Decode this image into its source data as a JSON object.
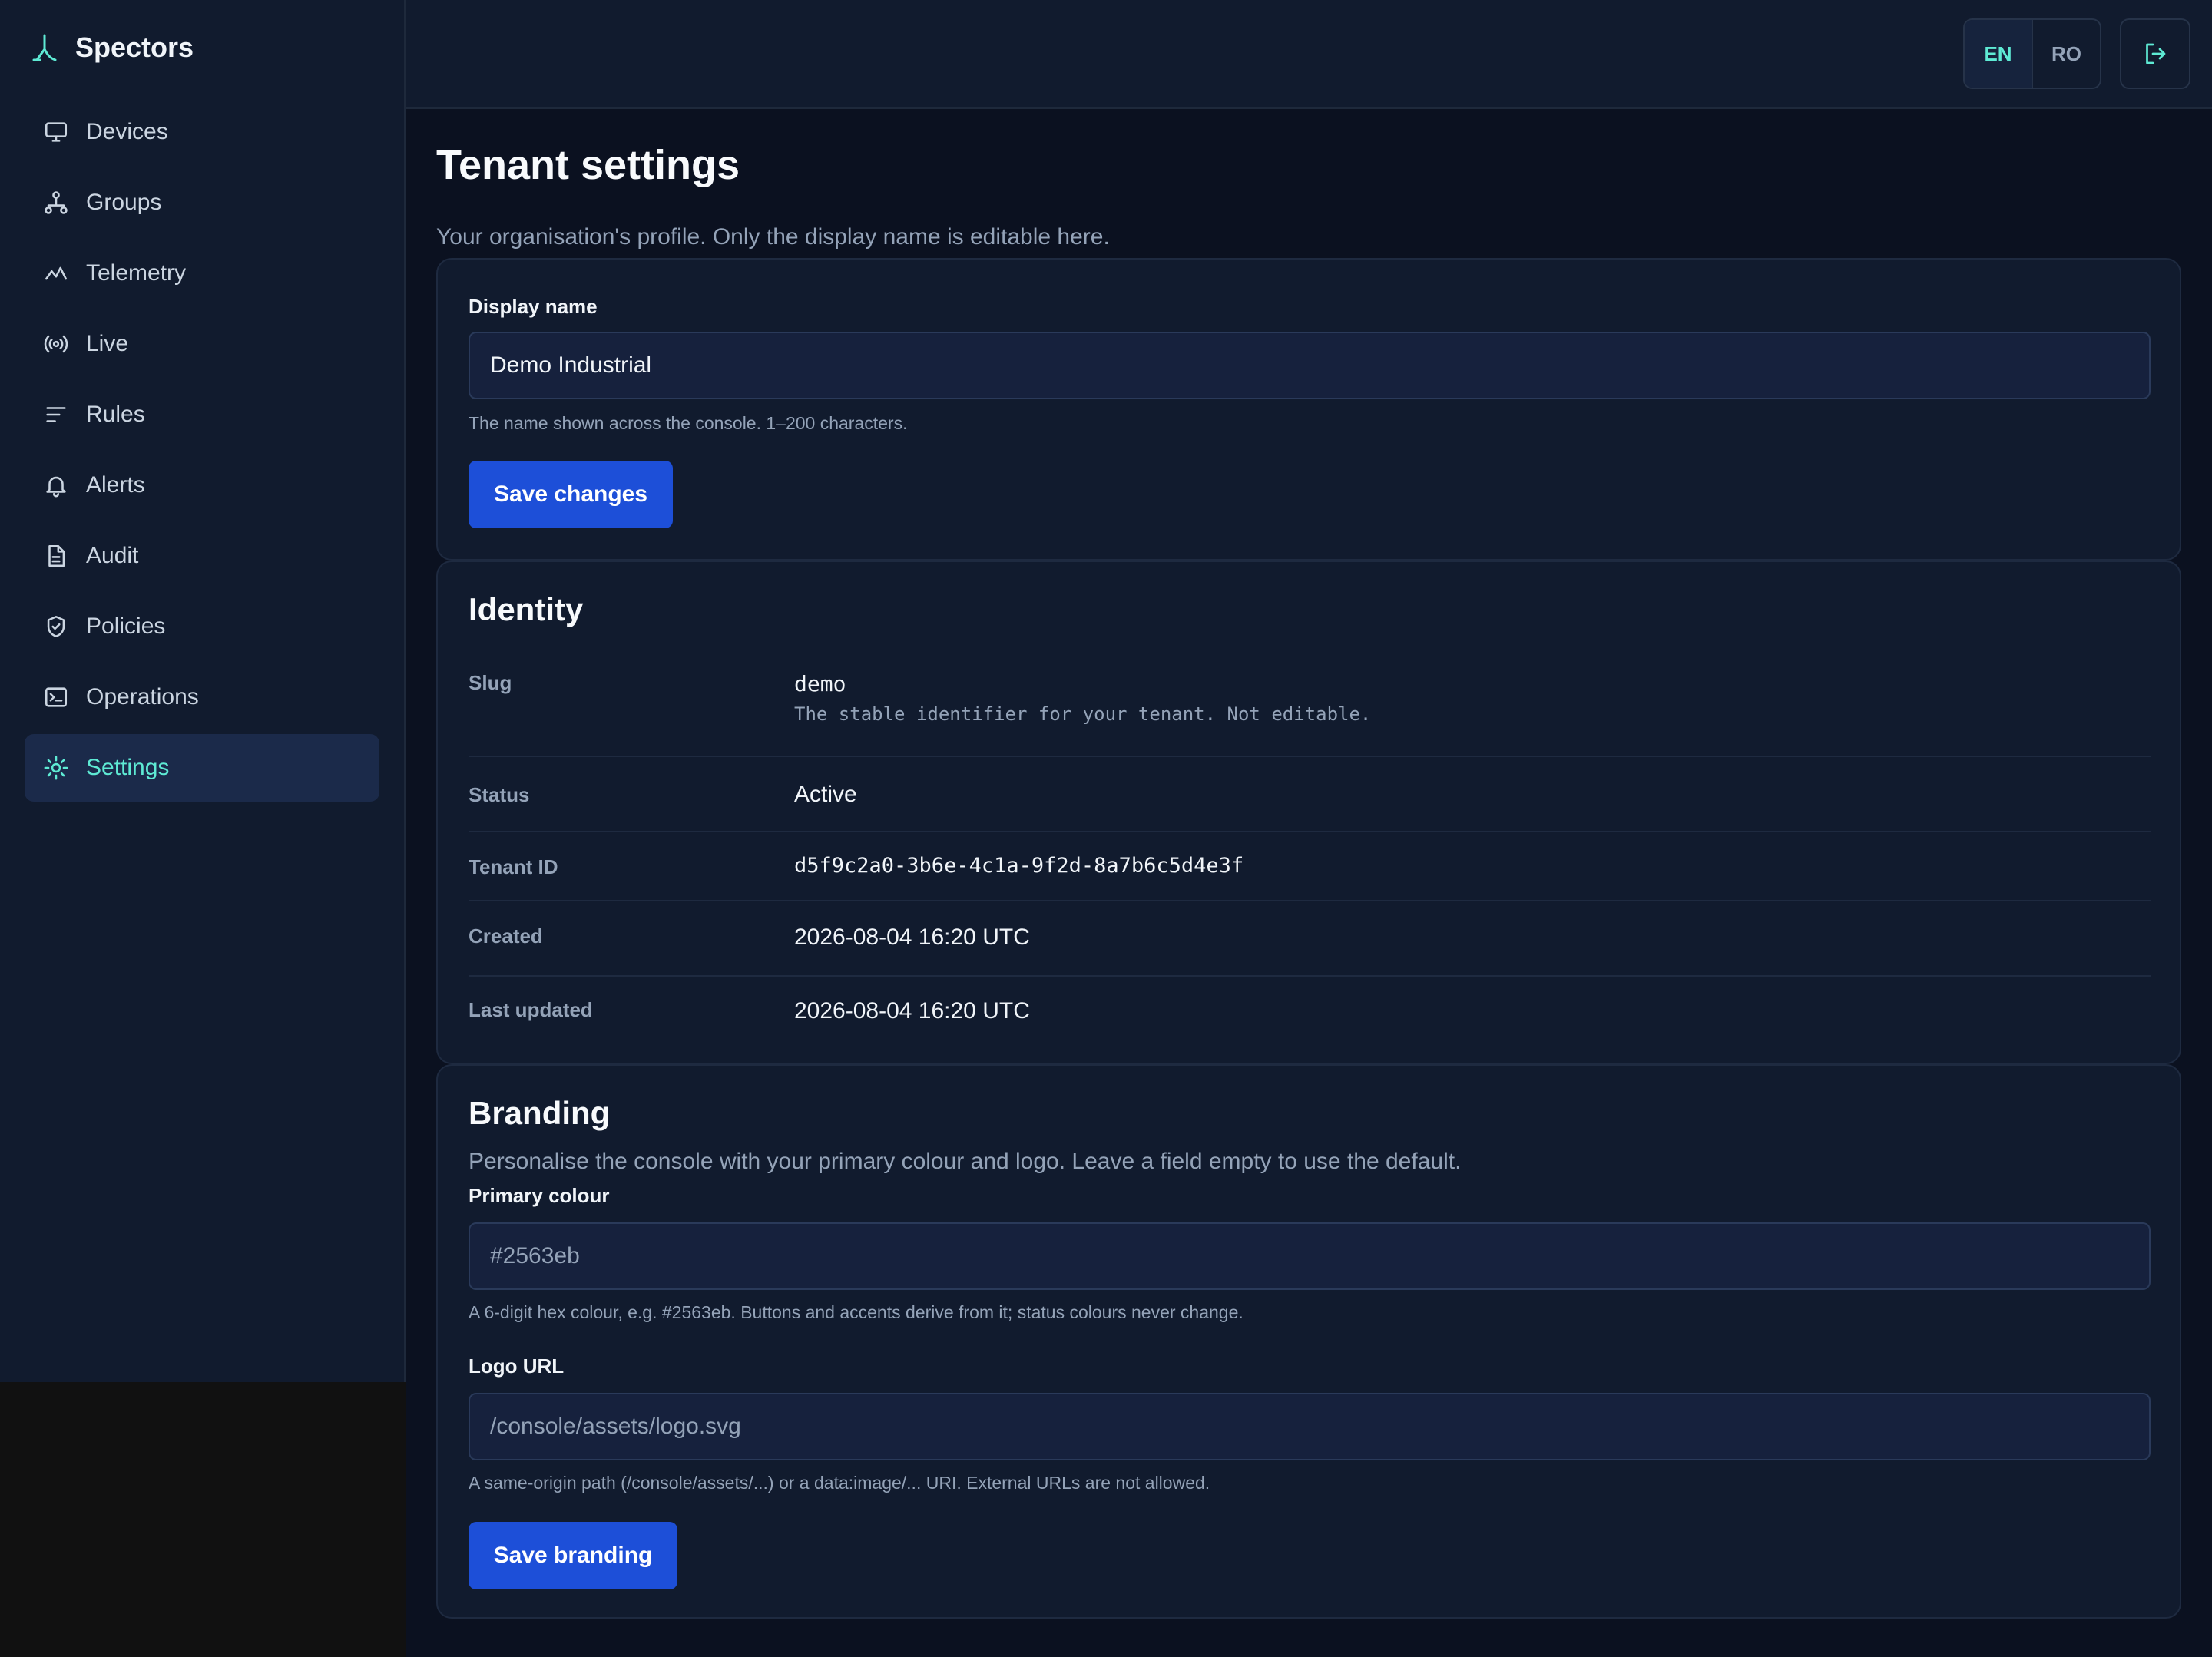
{
  "app": {
    "name": "Spectors"
  },
  "sidebar": {
    "items": [
      {
        "label": "Devices",
        "icon": "monitor-icon"
      },
      {
        "label": "Groups",
        "icon": "hierarchy-icon"
      },
      {
        "label": "Telemetry",
        "icon": "chart-line-icon"
      },
      {
        "label": "Live",
        "icon": "broadcast-icon"
      },
      {
        "label": "Rules",
        "icon": "lines-icon"
      },
      {
        "label": "Alerts",
        "icon": "bell-icon"
      },
      {
        "label": "Audit",
        "icon": "document-icon"
      },
      {
        "label": "Policies",
        "icon": "shield-icon"
      },
      {
        "label": "Operations",
        "icon": "terminal-icon"
      },
      {
        "label": "Settings",
        "icon": "gear-icon",
        "active": true
      }
    ]
  },
  "topbar": {
    "lang_en": "EN",
    "lang_ro": "RO",
    "selected_lang": "EN"
  },
  "page": {
    "title": "Tenant settings",
    "subtitle": "Your organisation's profile. Only the display name is editable here."
  },
  "display_name": {
    "label": "Display name",
    "value": "Demo Industrial",
    "help": "The name shown across the console. 1–200 characters.",
    "save_label": "Save changes"
  },
  "identity": {
    "title": "Identity",
    "slug_key": "Slug",
    "slug_value": "demo",
    "slug_help": "The stable identifier for your tenant. Not editable.",
    "status_key": "Status",
    "status_value": "Active",
    "tenant_id_key": "Tenant ID",
    "tenant_id_value": "d5f9c2a0-3b6e-4c1a-9f2d-8a7b6c5d4e3f",
    "created_key": "Created",
    "created_value": "2026-08-04 16:20 UTC",
    "updated_key": "Last updated",
    "updated_value": "2026-08-04 16:20 UTC"
  },
  "branding": {
    "title": "Branding",
    "description": "Personalise the console with your primary colour and logo. Leave a field empty to use the default.",
    "primary_label": "Primary colour",
    "primary_placeholder": "#2563eb",
    "primary_help": "A 6-digit hex colour, e.g. #2563eb. Buttons and accents derive from it; status colours never change.",
    "logo_label": "Logo URL",
    "logo_placeholder": "/console/assets/logo.svg",
    "logo_help": "A same-origin path (/console/assets/...) or a data:image/... URI. External URLs are not allowed.",
    "save_label": "Save branding"
  },
  "colors": {
    "accent": "#5eead4",
    "primary_button": "#1d4fd8",
    "background": "#0b1120",
    "surface": "#111b2e"
  }
}
